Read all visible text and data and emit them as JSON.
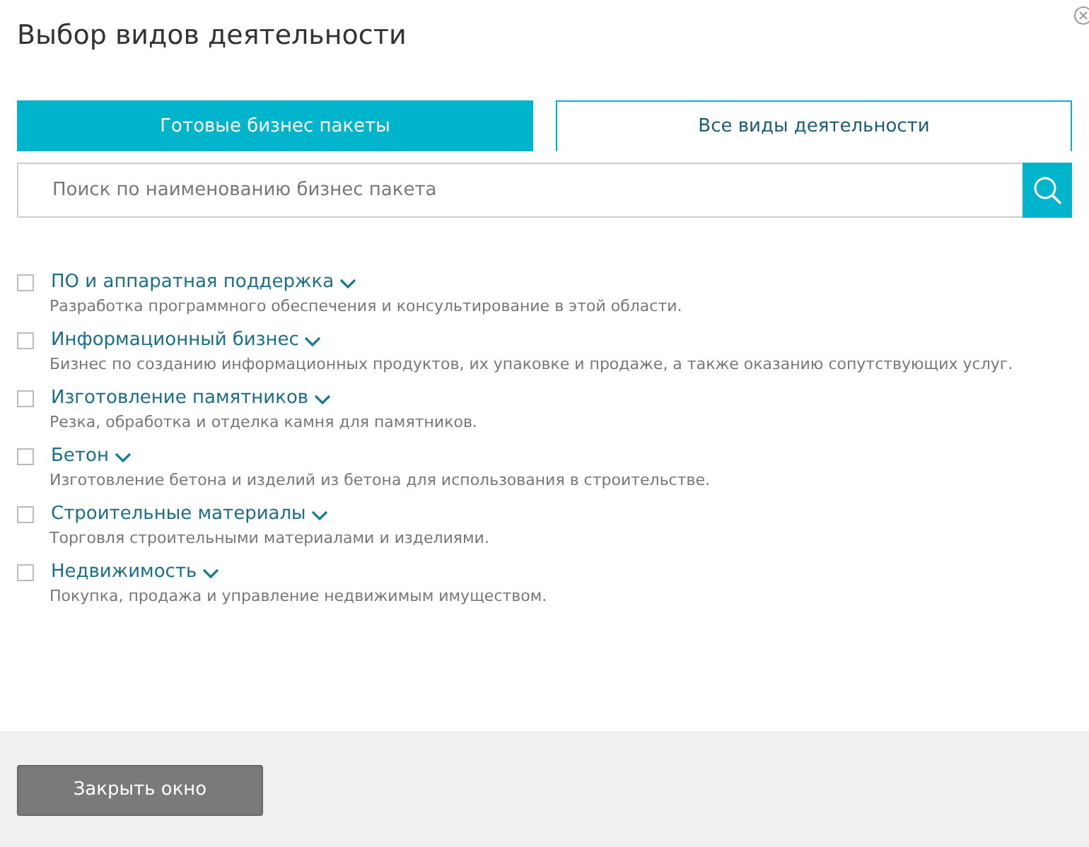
{
  "dialog": {
    "title": "Выбор видов деятельности"
  },
  "tabs": [
    {
      "label": "Готовые бизнес пакеты",
      "selected": true
    },
    {
      "label": "Все виды деятельности",
      "selected": false
    }
  ],
  "search": {
    "placeholder": "Поиск по наименованию бизнес пакета"
  },
  "activities": [
    {
      "name": "ПО и аппаратная поддержка",
      "description": "Разработка программного обеспечения и консультирование в этой области.",
      "checked": false
    },
    {
      "name": "Информационный бизнес",
      "description": "Бизнес по созданию информационных продуктов, их упаковке и продаже, а также оказанию сопутствующих услуг.",
      "checked": false
    },
    {
      "name": "Изготовление памятников",
      "description": "Резка, обработка и отделка камня для памятников.",
      "checked": false
    },
    {
      "name": "Бетон",
      "description": "Изготовление бетона и изделий из бетона для использования в строительстве.",
      "checked": false
    },
    {
      "name": "Строительные материалы",
      "description": "Торговля строительными материалами и изделиями.",
      "checked": false
    },
    {
      "name": "Недвижимость",
      "description": "Покупка, продажа и управление недвижимым имуществом.",
      "checked": false
    }
  ],
  "footer": {
    "close_button": "Закрыть окно"
  }
}
